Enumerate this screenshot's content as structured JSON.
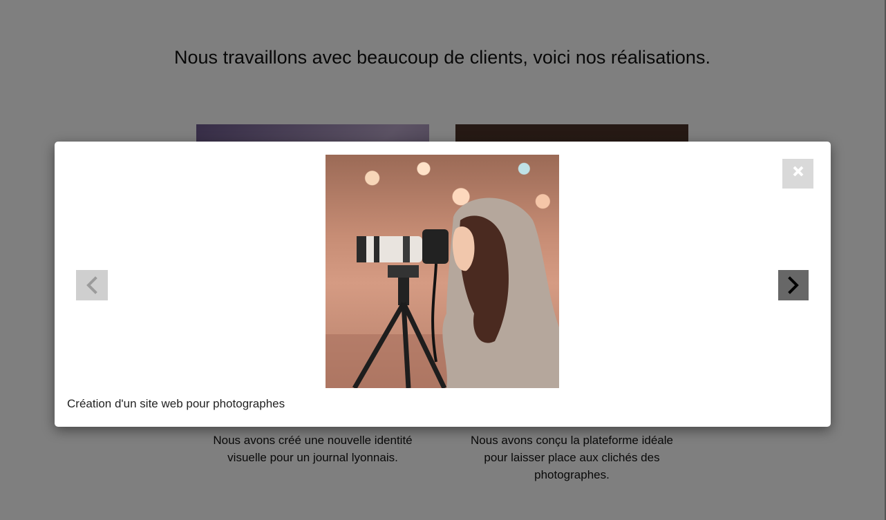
{
  "page": {
    "heading": "Nous travaillons avec beaucoup de clients, voici nos réalisations.",
    "cards": [
      {
        "description": "Nous avons créé une nouvelle identité visuelle pour un journal lyonnais."
      },
      {
        "description": "Nous avons conçu la plateforme idéale pour laisser place aux clichés des photographes."
      }
    ]
  },
  "modal": {
    "caption": "Création d'un site web pour photographes",
    "image_subject": "photographer with camera on tripod",
    "close_icon": "close-icon",
    "prev_icon": "chevron-left-icon",
    "next_icon": "chevron-right-icon"
  },
  "colors": {
    "overlay": "#000000",
    "prev_button_bg": "#cfcfcf",
    "next_button_bg": "#676767",
    "close_button_bg": "#d9d9d9"
  }
}
